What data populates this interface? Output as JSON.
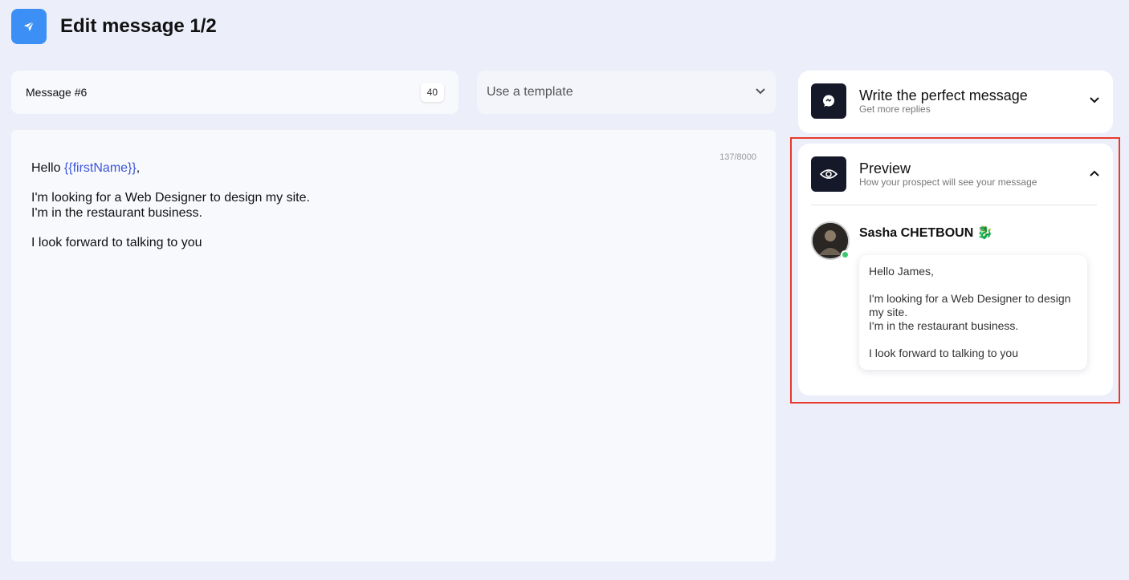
{
  "header": {
    "title": "Edit message 1/2",
    "icon": "send-icon",
    "accent": "#3b8ff5"
  },
  "message_name": {
    "value": "Message #6",
    "char_count": "40"
  },
  "template": {
    "placeholder": "Use a template"
  },
  "editor": {
    "counter": "137/8000",
    "greeting": "Hello ",
    "variable": "{{firstName}}",
    "greeting_end": ",",
    "line1": "I'm looking for a Web Designer to design my site.",
    "line2": "I'm in the restaurant business.",
    "line3": "I look forward to talking to you"
  },
  "tips_card": {
    "title": "Write the perfect message",
    "subtitle": "Get more replies",
    "icon": "chat-bubble-icon"
  },
  "preview_card": {
    "title": "Preview",
    "subtitle": "How your prospect will see your message",
    "icon": "eye-icon",
    "sender_name": "Sasha CHETBOUN 🐉",
    "status_color": "#3ec773",
    "bubble": {
      "greeting": "Hello James,",
      "line1": "I'm looking for a Web Designer to design my site.",
      "line2": "I'm in the restaurant business.",
      "line3": "I look forward to talking to you"
    }
  },
  "highlight_color": "#e8392a"
}
